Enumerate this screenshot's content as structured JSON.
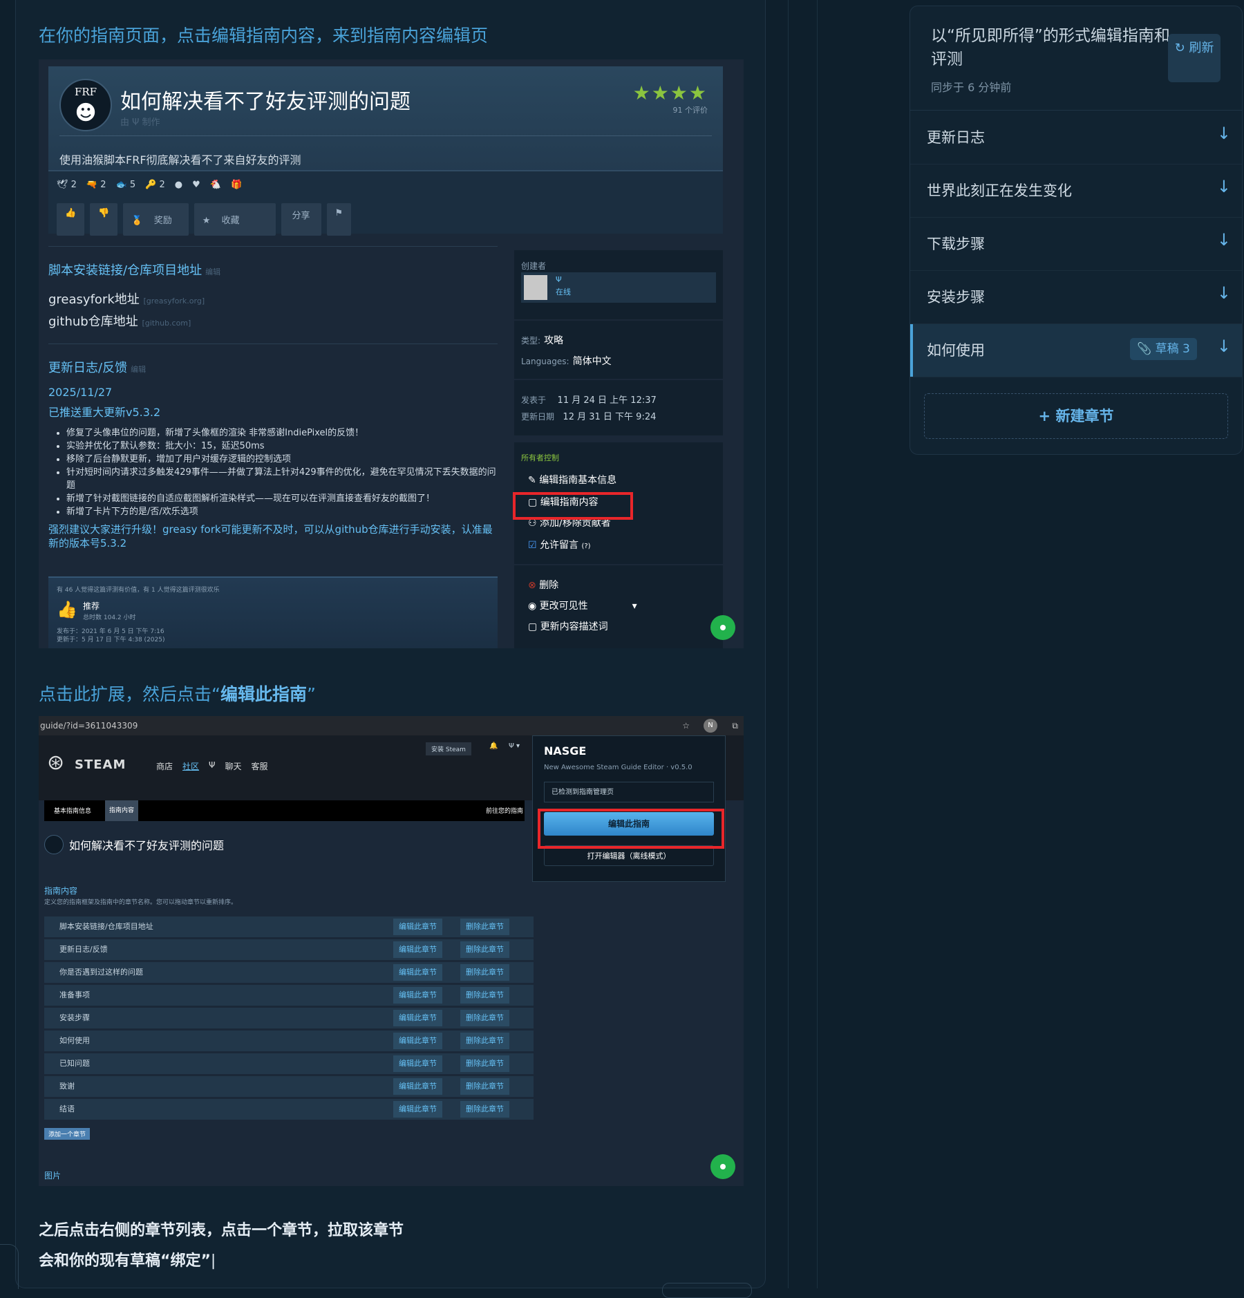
{
  "editor": {
    "para1": "在你的指南页面，点击编辑指南内容，来到指南内容编辑页",
    "para2_prefix": "点击此扩展，然后点击“",
    "para2_bold": "编辑此指南",
    "para2_suffix": "”",
    "para3_line1": "之后点击右侧的章节列表，点击一个章节，拉取该章节",
    "para3_line2": "会和你的现有草稿“绑定”"
  },
  "shot1": {
    "logo": "FRF",
    "title": "如何解决看不了好友评测的问题",
    "by": "由 Ψ 制作",
    "stars": "★★★★",
    "rating_count": "91 个评价",
    "description": "使用油猴脚本FRF彻底解决看不了来自好友的评测",
    "awards": [
      "2",
      "2",
      "5",
      "2"
    ],
    "btn_award": "奖励",
    "btn_fav": "收藏",
    "btn_share": "分享",
    "sec1_title": "脚本安装链接/仓库项目地址",
    "edit": "编辑",
    "greasy_label": "greasyfork地址",
    "greasy_domain": "[greasyfork.org]",
    "github_label": "github仓库地址",
    "github_domain": "[github.com]",
    "sec2_title": "更新日志/反馈",
    "date": "2025/11/27",
    "pushed": "已推送重大更新v5.3.2",
    "bullets": [
      "修复了头像串位的问题，新增了头像框的渲染 非常感谢IndiePixel的反馈！",
      "实验并优化了默认参数：批大小：15，延迟50ms",
      "移除了后台静默更新，增加了用户对缓存逻辑的控制选项",
      "针对短时间内请求过多触发429事件——并做了算法上针对429事件的优化，避免在罕见情况下丢失数据的问题",
      "新增了针对截图链接的自适应截图解析渲染样式——现在可以在评测直接查看好友的截图了！",
      "新增了卡片下方的是/否/欢乐选项"
    ],
    "suggest": "强烈建议大家进行升级！greasy fork可能更新不及时，可以从github仓库进行手动安装，认准最新的版本号5.3.2",
    "review_note": "有 46 人觉得这篇评测有价值，有 1 人觉得这篇评测很欢乐",
    "review_rec": "推荐",
    "review_hours": "总时数 104.2 小时",
    "review_posted": "发布于：2021 年 6 月 5 日 下午 7:16",
    "review_updated": "更新于：5 月 17 日 下午 4:38 (2025)",
    "creator_label": "创建者",
    "creator_name": "Ψ",
    "creator_status": "在线",
    "type_label": "类型:",
    "type_value": "攻略",
    "lang_label": "Languages:",
    "lang_value": "简体中文",
    "posted_label": "发表于",
    "posted_value": "11 月 24 日 上午 12:37",
    "updated_label": "更新日期",
    "updated_value": "12 月 31 日 下午 9:24",
    "owner_label": "所有者控制",
    "ctrl_basic": "编辑指南基本信息",
    "ctrl_content": "编辑指南内容",
    "ctrl_contrib": "添加/移除贡献者",
    "ctrl_comments": "允许留言",
    "ctrl_help": "(?)",
    "ctrl_delete": "删除",
    "ctrl_visibility": "更改可见性",
    "ctrl_desc": "更新内容描述词"
  },
  "shot2": {
    "url": "guide/?id=3611043309",
    "install_steam": "安装 Steam",
    "user_menu": "Ψ ▾",
    "steam_logo": "STEAM",
    "nav": [
      "商店",
      "社区",
      "Ψ",
      "聊天",
      "客服"
    ],
    "crumb1": "基本指南信息",
    "crumb2": "指南内容",
    "crumb_right": "前往您的指南",
    "guide_title": "如何解决看不了好友评测的问题",
    "content_label": "指南内容",
    "content_desc": "定义您的指南框架及指南中的章节名称。您可以拖动章节以重新排序。",
    "rows": [
      "脚本安装链接/仓库项目地址",
      "更新日志/反馈",
      "你是否遇到过这样的问题",
      "准备事项",
      "安装步骤",
      "如何使用",
      "已知问题",
      "致谢",
      "结语"
    ],
    "row_edit": "编辑此章节",
    "row_delete": "删除此章节",
    "add_section": "添加一个章节",
    "images_label": "图片",
    "popup_title": "NASGE",
    "popup_sub": "New Awesome Steam Guide Editor · v0.5.0",
    "popup_detect": "已检测到指南管理页",
    "popup_edit": "编辑此指南",
    "popup_open": "打开编辑器（离线模式）"
  },
  "sidebar": {
    "title": "以“所见即所得”的形式编辑指南和评测",
    "sync": "同步于 6 分钟前",
    "refresh": "↻ 刷新",
    "sections": [
      {
        "label": "更新日志"
      },
      {
        "label": "世界此刻正在发生变化"
      },
      {
        "label": "下载步骤"
      },
      {
        "label": "安装步骤"
      },
      {
        "label": "如何使用",
        "badge": "草稿 3"
      }
    ],
    "arrow": "↓",
    "new_section": "+ 新建章节"
  },
  "colors": {
    "accent": "#4aa3d9",
    "steam_link": "#66c0f4",
    "star": "#8bc53f",
    "red_box": "#e8262a",
    "green": "#22b24c"
  }
}
